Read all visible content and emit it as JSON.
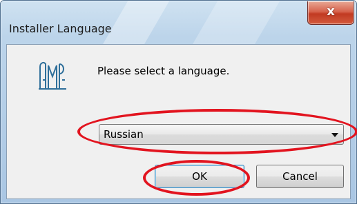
{
  "window": {
    "title": "Installer Language",
    "close_glyph": "x"
  },
  "dialog": {
    "prompt": "Please select a language.",
    "logo_icon": "installer-logo-icon"
  },
  "language_select": {
    "selected": "Russian",
    "arrow_icon": "dropdown-arrow-icon"
  },
  "buttons": {
    "ok_label": "OK",
    "cancel_label": "Cancel"
  },
  "colors": {
    "annotation": "#e2141f",
    "close_button": "#c13a22",
    "dialog_background": "#f0f0f0",
    "title_bar": "#bcd4ea"
  }
}
